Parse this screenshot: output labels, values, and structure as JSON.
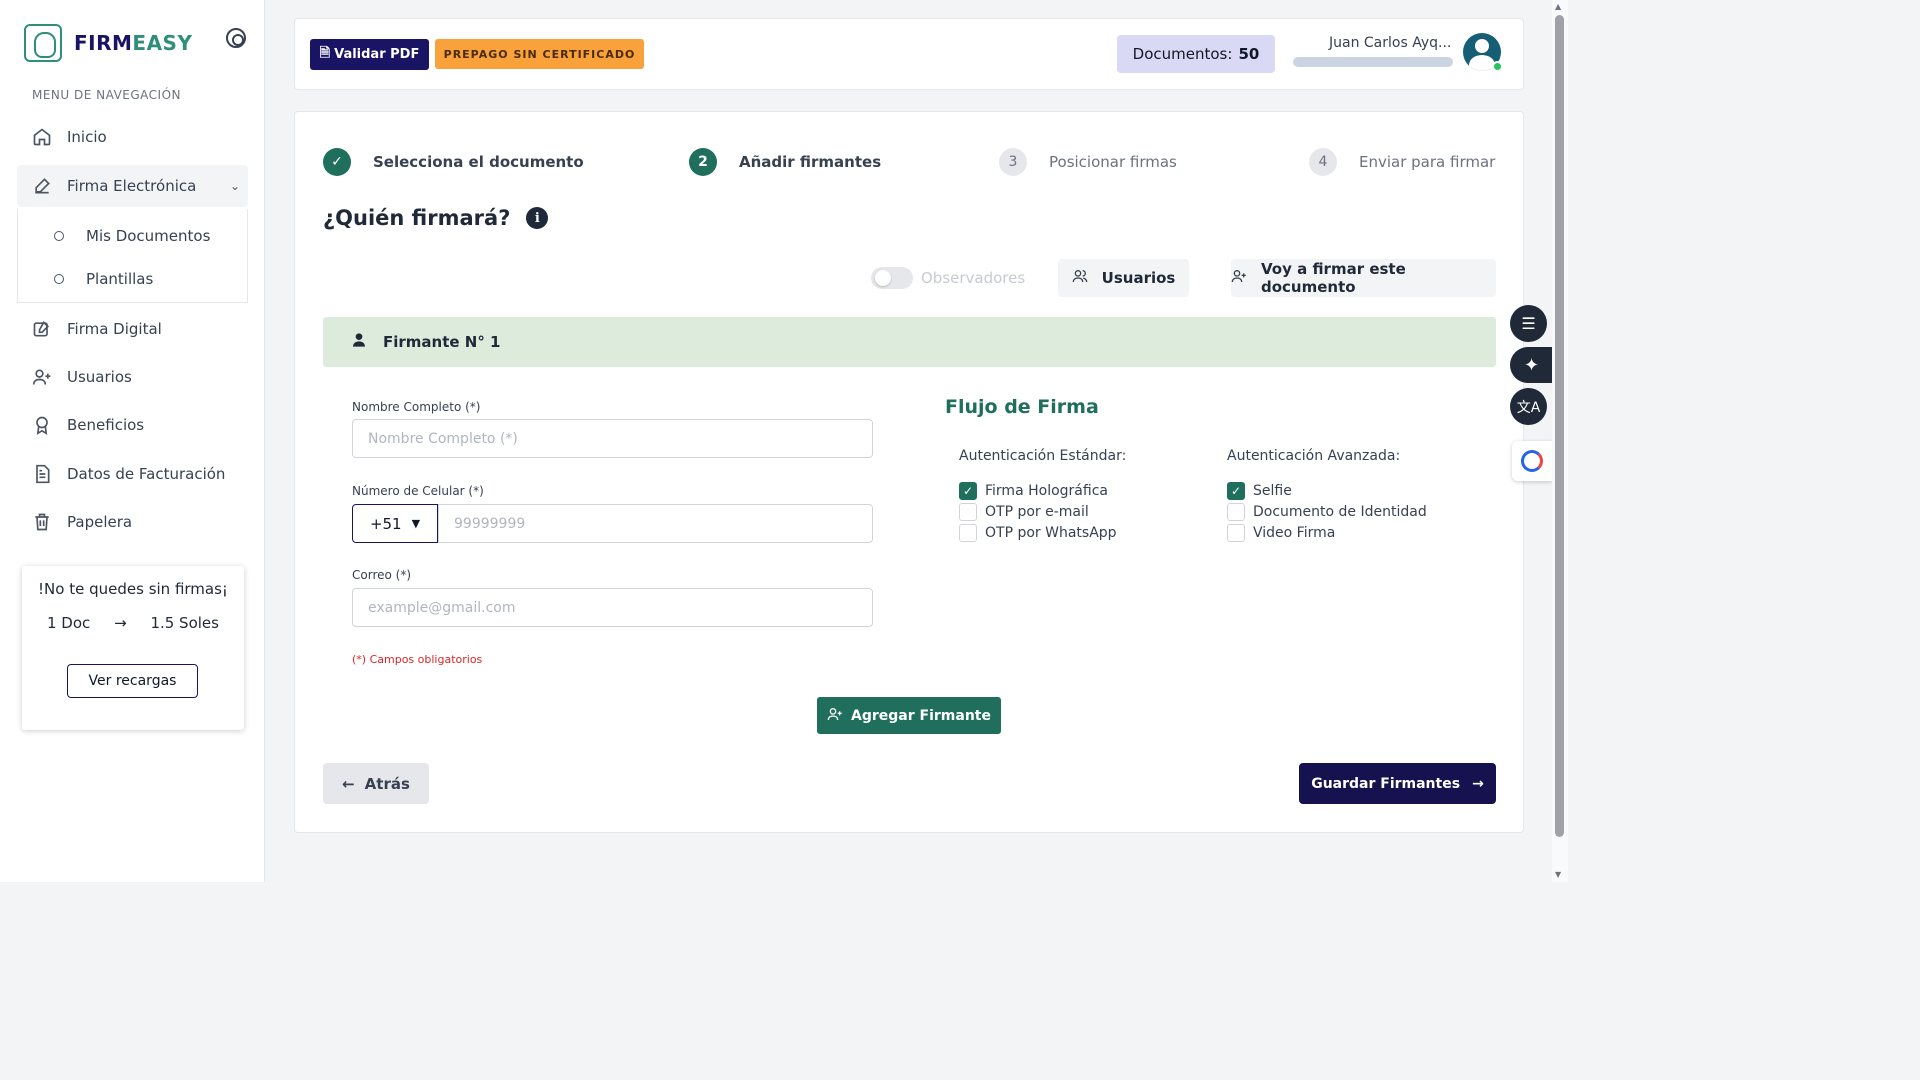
{
  "sidebar": {
    "logo_part1": "FIRM",
    "logo_part2": "EASY",
    "menu_title": "MENU DE NAVEGACIÓN",
    "items": [
      {
        "label": "Inicio",
        "icon": "home-icon"
      },
      {
        "label": "Firma Electrónica",
        "icon": "pen-icon"
      },
      {
        "label": "Firma Digital",
        "icon": "edit-icon"
      },
      {
        "label": "Usuarios",
        "icon": "user-plus-icon"
      },
      {
        "label": "Beneficios",
        "icon": "award-icon"
      },
      {
        "label": "Datos de Facturación",
        "icon": "file-text-icon"
      },
      {
        "label": "Papelera",
        "icon": "trash-icon"
      }
    ],
    "submenu": [
      "Mis Documentos",
      "Plantillas"
    ],
    "promo": {
      "title": "!No te quedes sin firmas¡",
      "left": "1 Doc",
      "arrow": "→",
      "right": "1.5 Soles",
      "button": "Ver recargas"
    }
  },
  "header": {
    "validate_button": "Validar PDF",
    "plan_badge": "PREPAGO SIN CERTIFICADO",
    "docs_label": "Documentos:",
    "docs_count": "50",
    "user_name": "Juan Carlos Ayq..."
  },
  "steps": [
    {
      "num": "✓",
      "label": "Selecciona el documento",
      "state": "done"
    },
    {
      "num": "2",
      "label": "Añadir firmantes",
      "state": "current"
    },
    {
      "num": "3",
      "label": "Posicionar firmas",
      "state": "pending"
    },
    {
      "num": "4",
      "label": "Enviar para firmar",
      "state": "pending"
    }
  ],
  "main": {
    "title": "¿Quién firmará?",
    "observers_label": "Observadores",
    "users_button": "Usuarios",
    "self_sign_button": "Voy a firmar este documento",
    "signer_header": "Firmante N° 1"
  },
  "form": {
    "name_label": "Nombre Completo (*)",
    "name_placeholder": "Nombre Completo (*)",
    "phone_label": "Número de Celular (*)",
    "country_code": "+51",
    "phone_placeholder": "99999999",
    "email_label": "Correo (*)",
    "email_placeholder": "example@gmail.com",
    "required_note": "(*) Campos obligatorios"
  },
  "flow": {
    "title": "Flujo de Firma",
    "standard_title": "Autenticación Estándar:",
    "standard_options": [
      {
        "label": "Firma Holográfica",
        "checked": true
      },
      {
        "label": "OTP por e-mail",
        "checked": false
      },
      {
        "label": "OTP por WhatsApp",
        "checked": false
      }
    ],
    "advanced_title": "Autenticación Avanzada:",
    "advanced_options": [
      {
        "label": "Selfie",
        "checked": true
      },
      {
        "label": "Documento de Identidad",
        "checked": false
      },
      {
        "label": "Video Firma",
        "checked": false
      }
    ]
  },
  "actions": {
    "add_signer": "Agregar Firmante",
    "back": "Atrás",
    "save": "Guardar Firmantes"
  },
  "colors": {
    "brand_navy": "#1a1464",
    "brand_green": "#1f6f5c",
    "accent_orange": "#f9a23c",
    "signer_bar": "#dcebdc"
  }
}
